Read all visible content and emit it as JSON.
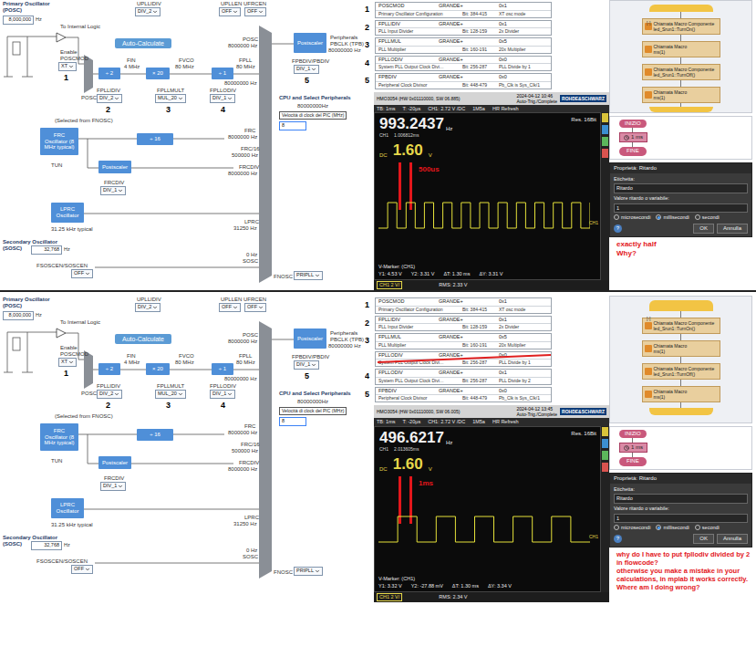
{
  "clock_diagram": {
    "items": [
      {
        "kind": "title",
        "text": "Primary Oscillator"
      },
      {
        "kind": "title",
        "text": "(POSC)"
      },
      {
        "kind": "field",
        "text": "8,000,000",
        "unit": "Hz"
      },
      {
        "kind": "text",
        "text": "UPLLIDIV"
      },
      {
        "kind": "dropdown",
        "text": "DIV_2"
      },
      {
        "kind": "text",
        "text": "UPLLEN UFRCEN"
      },
      {
        "kind": "dropdown",
        "text": "OFF"
      },
      {
        "kind": "dropdown",
        "text": "OFF"
      },
      {
        "kind": "text",
        "text": "To Internal Logic"
      },
      {
        "kind": "text",
        "text": "Enable"
      },
      {
        "kind": "text",
        "text": "POSCMOD"
      },
      {
        "kind": "dropdown",
        "text": "XT"
      },
      {
        "kind": "num",
        "text": "1"
      },
      {
        "kind": "button",
        "text": "Auto-Calculate"
      },
      {
        "kind": "block",
        "text": "÷ 2"
      },
      {
        "kind": "text",
        "text": "FIN"
      },
      {
        "kind": "text",
        "text": "4 MHz"
      },
      {
        "kind": "block",
        "text": "× 20"
      },
      {
        "kind": "text",
        "text": "FVCO"
      },
      {
        "kind": "text",
        "text": "80 MHz"
      },
      {
        "kind": "block",
        "text": "÷ 1"
      },
      {
        "kind": "text",
        "text": "FPLL"
      },
      {
        "kind": "text",
        "text": "80 MHz"
      },
      {
        "kind": "text",
        "text": "FPLLIDIV"
      },
      {
        "kind": "dropdown",
        "text": "DIV_2"
      },
      {
        "kind": "num",
        "text": "2"
      },
      {
        "kind": "text",
        "text": "FPLLMULT"
      },
      {
        "kind": "dropdown",
        "text": "MUL_20"
      },
      {
        "kind": "num",
        "text": "3"
      },
      {
        "kind": "text",
        "text": "FPLLODIV"
      },
      {
        "kind": "dropdown",
        "text": "DIV_1"
      },
      {
        "kind": "num",
        "text": "4"
      },
      {
        "kind": "text",
        "text": "POSC"
      },
      {
        "kind": "text",
        "text": "(Selected from FNOSC)"
      },
      {
        "kind": "block",
        "text": "FRC Oscillator (8 MHz typical)"
      },
      {
        "kind": "text",
        "text": "TUN"
      },
      {
        "kind": "text",
        "text": "POSC"
      },
      {
        "kind": "text",
        "text": "8000000 Hz"
      },
      {
        "kind": "text",
        "text": "80000000 Hz"
      },
      {
        "kind": "block",
        "text": "Postscaler"
      },
      {
        "kind": "text",
        "text": "Peripherals"
      },
      {
        "kind": "text",
        "text": "PBCLK (TPB)"
      },
      {
        "kind": "text",
        "text": "80000000 Hz"
      },
      {
        "kind": "text",
        "text": "FPBDIV/PBDIV"
      },
      {
        "kind": "dropdown",
        "text": "DIV_1"
      },
      {
        "kind": "num",
        "text": "5"
      },
      {
        "kind": "title",
        "text": "CPU and Select Peripherals"
      },
      {
        "kind": "text",
        "text": "80000000Hz"
      },
      {
        "kind": "picfield",
        "text": "Velocità di clock del PIC (MHz)",
        "value": "8"
      },
      {
        "kind": "text",
        "text": "FRC"
      },
      {
        "kind": "text",
        "text": "8000000 Hz"
      },
      {
        "kind": "text",
        "text": "FRC/16"
      },
      {
        "kind": "text",
        "text": "500000 Hz"
      },
      {
        "kind": "text",
        "text": "FRCDIV"
      },
      {
        "kind": "text",
        "text": "8000000 Hz"
      },
      {
        "kind": "block",
        "text": "÷ 16"
      },
      {
        "kind": "block",
        "text": "Postscaler"
      },
      {
        "kind": "text",
        "text": "FRCDIV"
      },
      {
        "kind": "dropdown",
        "text": "DIV_1"
      },
      {
        "kind": "block",
        "text": "LPRC Oscillator"
      },
      {
        "kind": "text",
        "text": "31.25 kHz typical"
      },
      {
        "kind": "text",
        "text": "LPRC"
      },
      {
        "kind": "text",
        "text": "31250 Hz"
      },
      {
        "kind": "title",
        "text": "Secondary Oscillator"
      },
      {
        "kind": "title",
        "text": "(SOSC)"
      },
      {
        "kind": "field",
        "text": "32,768",
        "unit": "Hz"
      },
      {
        "kind": "text",
        "text": "FSOSCEN/SOSCEN"
      },
      {
        "kind": "dropdown",
        "text": "OFF"
      },
      {
        "kind": "text",
        "text": "0 Hz"
      },
      {
        "kind": "text",
        "text": "SOSC"
      },
      {
        "kind": "text",
        "text": "FNOSC"
      },
      {
        "kind": "dropdown",
        "text": "PRIPLL"
      }
    ]
  },
  "halves": [
    {
      "config": [
        {
          "num": "1",
          "name": "POSCMOD",
          "grade": "GRANDE+",
          "value": "0x1",
          "desc": "Primary Oscillator Configuration",
          "bits": "Bit: 384-415",
          "setting": "XT osc mode",
          "struck": false
        },
        {
          "num": "2",
          "name": "FPLLIDIV",
          "grade": "GRANDE+",
          "value": "0x1",
          "desc": "PLL Input Divider",
          "bits": "Bit: 128-159",
          "setting": "2x Divider",
          "struck": false
        },
        {
          "num": "3",
          "name": "FPLLMUL",
          "grade": "GRANDE+",
          "value": "0x5",
          "desc": "PLL Multiplier",
          "bits": "Bit: 160-191",
          "setting": "20x Multiplier",
          "struck": false
        },
        {
          "num": "4",
          "name": "FPLLODIV",
          "grade": "GRANDE+",
          "value": "0x0",
          "desc": "System PLL Output Clock Divi…",
          "bits": "Bit: 256-287",
          "setting": "PLL Divide by 1",
          "struck": false
        },
        {
          "num": "5",
          "name": "FPBDIV",
          "grade": "GRANDE+",
          "value": "0x0",
          "desc": "Peripheral Clock Divisor",
          "bits": "Bit: 448-479",
          "setting": "Pb_Clk is Sys_Clk/1",
          "struck": false
        }
      ],
      "scope": {
        "model": "HMO3054 (HW 0x01110000, SW 06.885)",
        "datetime": "2024-04-12 10:46",
        "trigger": "Auto-Trig./Complete",
        "brand": "ROHDE&SCHWARZ",
        "status": [
          "TB: 1ms",
          "T: -20µs",
          "CH1: 2.72 V /DC",
          "1M5a",
          "HR Refresh"
        ],
        "freq": "993.2437",
        "freq_unit": "Hz",
        "channel": "CH1",
        "period": "1.006812ms",
        "res": "Res. 16Bit",
        "coupling": "DC",
        "level": "1.60",
        "level_unit": "V",
        "annotation": "500us",
        "cycles": 11.5,
        "marker_title": "V-Marker: (CH1)",
        "readings": [
          "Y1: 4.53 V",
          "Y2: 3.31 V",
          "ΔT: 1.30 ms",
          "ΔY: 3.31 V"
        ],
        "scale": "CH1 2 V/",
        "rms": "RMS: 2.33 V"
      },
      "flow": {
        "collapse": "[-]",
        "blocks": [
          {
            "title": "Chiamata Macro Componente",
            "call": "led_Srun1::TurnOn()"
          },
          {
            "title": "Chiamata Macro",
            "call": "ms(1)"
          },
          {
            "title": "Chiamata Macro Componente",
            "call": "led_Srun1::TurnOff()"
          },
          {
            "title": "Chiamata Macro",
            "call": "ms(1)"
          }
        ]
      },
      "editor": {
        "start": "INIZIO",
        "delay": "1 ms",
        "end": "FINE"
      },
      "dialog": {
        "title": "Proprietà: Ritardo",
        "label_caption": "Etichetta:",
        "label_value": "Ritardo",
        "value_caption": "Valore ritardo o variabile:",
        "value": "1",
        "units": [
          {
            "label": "microsecondi",
            "selected": false
          },
          {
            "label": "millisecondi",
            "selected": true
          },
          {
            "label": "secondi",
            "selected": false
          }
        ],
        "help": "?",
        "buttons": [
          "OK",
          "Annulla"
        ]
      },
      "note": [
        "exactly half",
        "Why?"
      ]
    },
    {
      "config": [
        {
          "num": "1",
          "name": "POSCMOD",
          "grade": "GRANDE+",
          "value": "0x1",
          "desc": "Primary Oscillator Configuration",
          "bits": "Bit: 384-415",
          "setting": "XT osc mode",
          "struck": false
        },
        {
          "num": "2",
          "name": "FPLLIDIV",
          "grade": "GRANDE+",
          "value": "0x1",
          "desc": "PLL Input Divider",
          "bits": "Bit: 128-159",
          "setting": "2x Divider",
          "struck": false
        },
        {
          "num": "3",
          "name": "FPLLMUL",
          "grade": "GRANDE+",
          "value": "0x5",
          "desc": "PLL Multiplier",
          "bits": "Bit: 160-191",
          "setting": "20x Multiplier",
          "struck": false
        },
        {
          "name": "FPLLODIV",
          "grade": "GRANDE+",
          "value": "0x0",
          "desc": "System PLL Output Clock Divi…",
          "bits": "Bit: 256-287",
          "setting": "PLL Divide by 1",
          "struck": true
        },
        {
          "num": "4",
          "name": "FPLLODIV",
          "grade": "GRANDE+",
          "value": "0x1",
          "desc": "System PLL Output Clock Divi…",
          "bits": "Bit: 256-287",
          "setting": "PLL Divide by 2",
          "struck": false
        },
        {
          "num": "5",
          "name": "FPBDIV",
          "grade": "GRANDE+",
          "value": "0x0",
          "desc": "Peripheral Clock Divisor",
          "bits": "Bit: 448-479",
          "setting": "Pb_Clk is Sys_Clk/1",
          "struck": false
        }
      ],
      "scope": {
        "model": "HMO3054 (HW 0x01110000, SW 06.005)",
        "datetime": "2024-04-12 13:45",
        "trigger": "Auto-Trig./Complete",
        "brand": "ROHDE&SCHWARZ",
        "status": [
          "TB: 1ms",
          "T: -20µs",
          "CH1: 2.72 V /DC",
          "1M5a",
          "HR Refresh"
        ],
        "freq": "496.6217",
        "freq_unit": "Hz",
        "channel": "CH1",
        "period": "2.013605ms",
        "res": "Res. 16Bit",
        "coupling": "DC",
        "level": "1.60",
        "level_unit": "V",
        "annotation": "1ms",
        "cycles": 5.5,
        "marker_title": "V-Marker: (CH1)",
        "readings": [
          "Y1: 3.32 V",
          "Y2: -27.88 mV",
          "ΔT: 1.30 ms",
          "ΔY: 3.34 V"
        ],
        "scale": "CH1 2 V/",
        "rms": "RMS: 2.34 V"
      },
      "flow": {
        "collapse": "[-]",
        "blocks": [
          {
            "title": "Chiamata Macro Componente",
            "call": "led_Srun1::TurnOn()"
          },
          {
            "title": "Chiamata Macro",
            "call": "ms(1)"
          },
          {
            "title": "Chiamata Macro Componente",
            "call": "led_Srun1::TurnOff()"
          },
          {
            "title": "Chiamata Macro",
            "call": "ms(1)"
          }
        ]
      },
      "editor": {
        "start": "INIZIO",
        "delay": "1 ms",
        "end": "FINE"
      },
      "dialog": {
        "title": "Proprietà: Ritardo",
        "label_caption": "Etichetta:",
        "label_value": "Ritardo",
        "value_caption": "Valore ritardo o variabile:",
        "value": "1",
        "units": [
          {
            "label": "microsecondi",
            "selected": false
          },
          {
            "label": "millisecondi",
            "selected": true
          },
          {
            "label": "secondi",
            "selected": false
          }
        ],
        "help": "?",
        "buttons": [
          "OK",
          "Annulla"
        ]
      },
      "note": [
        "why do I have to put fpllodiv divided by 2 in flowcode?",
        "otherwise you make a mistake in your calculations, in mplab it works correctly.",
        "Where am I doing wrong?"
      ]
    }
  ]
}
